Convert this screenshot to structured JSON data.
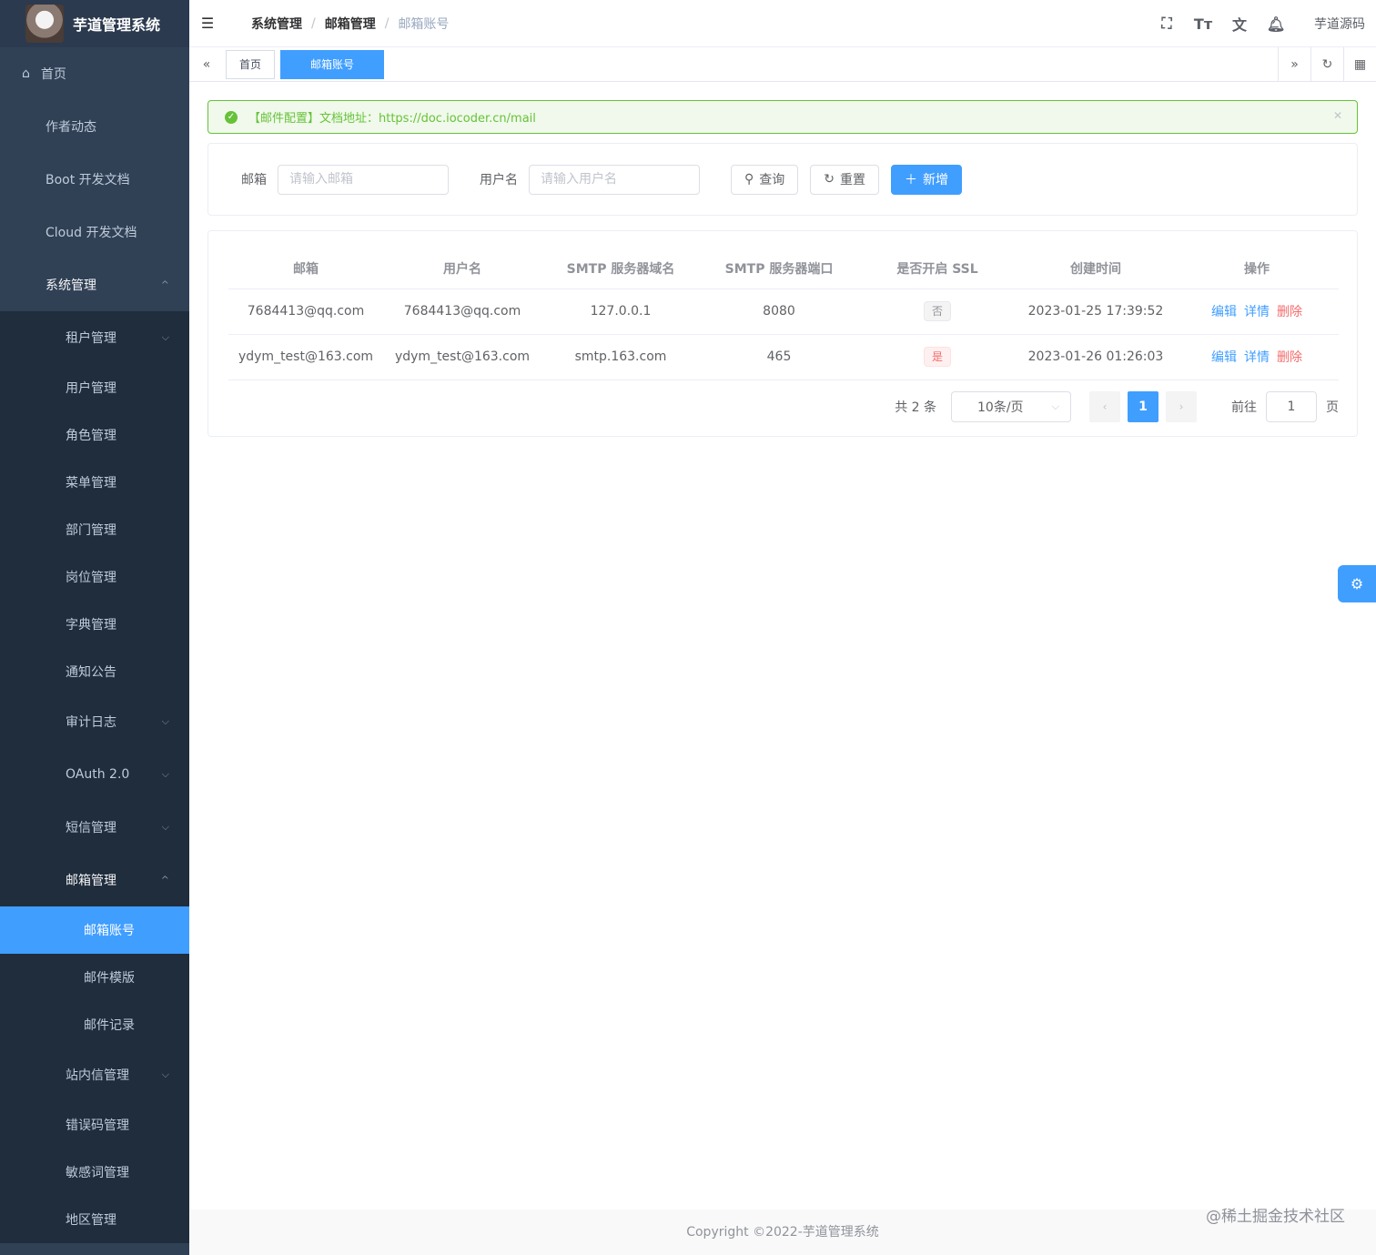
{
  "app": {
    "title": "芋道管理系统"
  },
  "sidebar": {
    "home": "首页",
    "top_items": [
      "作者动态",
      "Boot 开发文档",
      "Cloud 开发文档"
    ],
    "system": "系统管理",
    "sub_items": {
      "tenant": "租户管理",
      "user": "用户管理",
      "role": "角色管理",
      "menu": "菜单管理",
      "dept": "部门管理",
      "post": "岗位管理",
      "dict": "字典管理",
      "notice": "通知公告",
      "audit": "审计日志",
      "oauth": "OAuth 2.0",
      "sms": "短信管理",
      "mail": "邮箱管理"
    },
    "mail_children": [
      "邮箱账号",
      "邮件模版",
      "邮件记录"
    ],
    "after_items": {
      "site_msg": "站内信管理",
      "error_code": "错误码管理",
      "sensitive": "敏感词管理",
      "area": "地区管理"
    }
  },
  "navbar": {
    "breadcrumb": [
      "系统管理",
      "邮箱管理",
      "邮箱账号"
    ],
    "user": "芋道源码"
  },
  "tags": {
    "home": "首页",
    "current": "邮箱账号"
  },
  "alert": {
    "text": "【邮件配置】文档地址：https://doc.iocoder.cn/mail"
  },
  "search": {
    "mail_label": "邮箱",
    "mail_placeholder": "请输入邮箱",
    "username_label": "用户名",
    "username_placeholder": "请输入用户名",
    "query": "查询",
    "reset": "重置",
    "add": "新增"
  },
  "table": {
    "headers": [
      "邮箱",
      "用户名",
      "SMTP 服务器域名",
      "SMTP 服务器端口",
      "是否开启 SSL",
      "创建时间",
      "操作"
    ],
    "rows": [
      {
        "mail": "7684413@qq.com",
        "username": "7684413@qq.com",
        "host": "127.0.0.1",
        "port": "8080",
        "ssl": "否",
        "created": "2023-01-25 17:39:52"
      },
      {
        "mail": "ydym_test@163.com",
        "username": "ydym_test@163.com",
        "host": "smtp.163.com",
        "port": "465",
        "ssl": "是",
        "created": "2023-01-26 01:26:03"
      }
    ],
    "actions": {
      "edit": "编辑",
      "detail": "详情",
      "delete": "删除"
    }
  },
  "pagination": {
    "total": "共 2 条",
    "size": "10条/页",
    "current": "1",
    "goto": "前往",
    "jump": "1",
    "page_suffix": "页"
  },
  "footer": {
    "copyright": "Copyright ©2022-芋道管理系统"
  },
  "watermark": "@稀土掘金技术社区",
  "colors": {
    "primary": "#409eff",
    "sidebar": "#304156",
    "success": "#67c23a",
    "danger": "#f56c6c"
  }
}
